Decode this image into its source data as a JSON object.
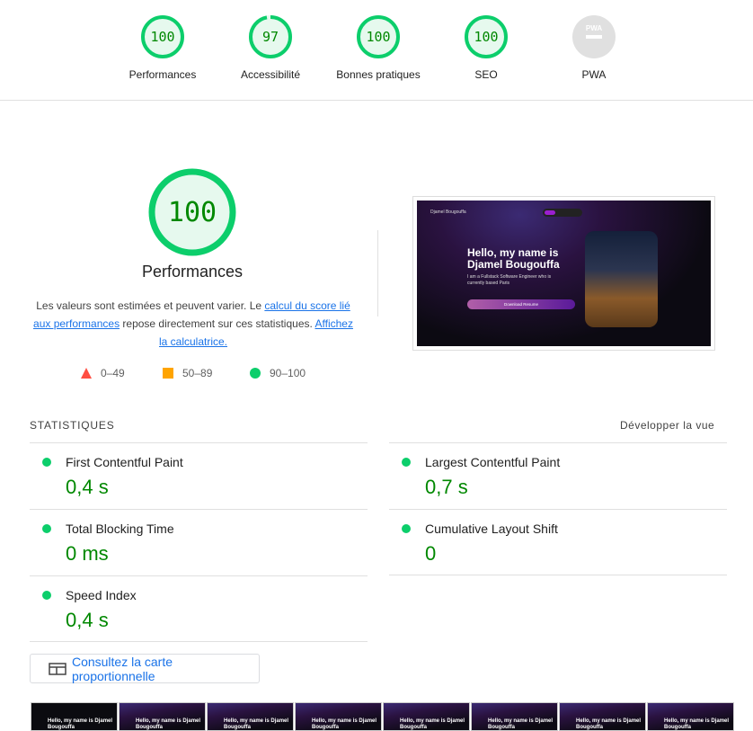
{
  "categories": [
    {
      "label": "Performances",
      "score": "100",
      "value": 100,
      "color": "#0cce6b"
    },
    {
      "label": "Accessibilité",
      "score": "97",
      "value": 97,
      "color": "#0cce6b"
    },
    {
      "label": "Bonnes pratiques",
      "score": "100",
      "value": 100,
      "color": "#0cce6b"
    },
    {
      "label": "SEO",
      "score": "100",
      "value": 100,
      "color": "#0cce6b"
    },
    {
      "label": "PWA",
      "score": "PWA",
      "value": null,
      "color": "#9e9e9e"
    }
  ],
  "main": {
    "score": "100",
    "title": "Performances",
    "desc_1": "Les valeurs sont estimées et peuvent varier. Le ",
    "link_1": "calcul du score lié aux performances",
    "desc_2": " repose directement sur ces statistiques. ",
    "link_2": "Affichez la calculatrice."
  },
  "legend": [
    {
      "range": "0–49",
      "color": "#ff4e42",
      "shape": "triangle"
    },
    {
      "range": "50–89",
      "color": "#ffa400",
      "shape": "square"
    },
    {
      "range": "90–100",
      "color": "#0cce6b",
      "shape": "circle"
    }
  ],
  "screenshot": {
    "heading": "Hello, my name is Djamel Bougouffa",
    "sub": "I am a Fullstack Software Engineer who is currently based Paris",
    "brand": "Djamel Bougouffa",
    "cta": "Download Resume"
  },
  "stats": {
    "heading": "STATISTIQUES",
    "toggle": "Développer la vue",
    "metrics": [
      {
        "name": "First Contentful Paint",
        "value": "0,4 s"
      },
      {
        "name": "Largest Contentful Paint",
        "value": "0,7 s"
      },
      {
        "name": "Total Blocking Time",
        "value": "0 ms"
      },
      {
        "name": "Cumulative Layout Shift",
        "value": "0"
      },
      {
        "name": "Speed Index",
        "value": "0,4 s"
      }
    ]
  },
  "treemap_button": "Consultez la carte proportionnelle",
  "filmstrip": {
    "frame_text": "Hello, my name is Djamel Bougouffa"
  }
}
